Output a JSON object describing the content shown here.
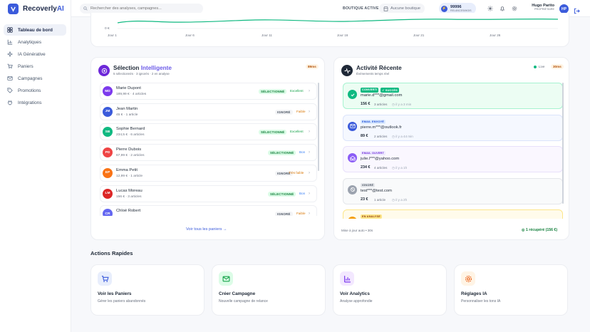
{
  "brand": {
    "name": "Recoverly",
    "accent": "AI"
  },
  "sidebar": {
    "items": [
      {
        "label": "Tableau de bord",
        "icon": "dashboard-icon",
        "active": true
      },
      {
        "label": "Analytiques",
        "icon": "chart-icon"
      },
      {
        "label": "IA Générative",
        "icon": "sparkle-icon"
      },
      {
        "label": "Paniers",
        "icon": "cart-icon"
      },
      {
        "label": "Campagnes",
        "icon": "mail-icon"
      },
      {
        "label": "Promotions",
        "icon": "tag-icon"
      },
      {
        "label": "Intégrations",
        "icon": "plug-icon"
      }
    ]
  },
  "topbar": {
    "search_placeholder": "Rechercher des analyses, campagnes...",
    "shop_label": "BOUTIQUE ACTIVE",
    "shop_value": "Aucune boutique",
    "credits_value": "99996",
    "credits_label": "RELANCES/MOIS",
    "user_name": "Hugo Parito",
    "user_role": "PROPRIÉTAIRE",
    "user_initials": "HP"
  },
  "chart": {
    "y_zero": "0 €",
    "x_labels": [
      "Jour 1",
      "Jour 6",
      "Jour 11",
      "Jour 16",
      "Jour 21",
      "Jour 26"
    ]
  },
  "chart_data": {
    "type": "line",
    "x": [
      "Jour 1",
      "Jour 6",
      "Jour 11",
      "Jour 16",
      "Jour 21",
      "Jour 26"
    ],
    "values": [
      0,
      0,
      0,
      0,
      0,
      0
    ],
    "accent": "#10b981"
  },
  "selection": {
    "title_a": "Sélection ",
    "title_b": "Intelligente",
    "subtitle": "5 sélectionnés · 3 ignorés · 2 en analyse",
    "timing": "89ms",
    "rows": [
      {
        "initials": "MD",
        "color": "#7c3aed",
        "name": "Marie Dupont",
        "meta": "189,99 € · 4 articles",
        "status": "SÉLECTIONNÉ",
        "status_kind": "sel",
        "quality": "Excellent",
        "quality_color": "#16a34a"
      },
      {
        "initials": "JM",
        "color": "#3b5bdb",
        "name": "Jean Martin",
        "meta": "45 € · 1 article",
        "status": "IGNORÉ",
        "status_kind": "ign",
        "quality": "Faible",
        "quality_color": "#d97706"
      },
      {
        "initials": "SB",
        "color": "#10b981",
        "name": "Sophie Bernard",
        "meta": "234,5 € · 6 articles",
        "status": "SÉLECTIONNÉ",
        "status_kind": "sel",
        "quality": "Excellent",
        "quality_color": "#16a34a"
      },
      {
        "initials": "PD",
        "color": "#ef4444",
        "name": "Pierre Dubois",
        "meta": "67,99 € · 2 articles",
        "status": "SÉLECTIONNÉ",
        "status_kind": "sel",
        "quality": "Bon",
        "quality_color": "#3b82f6"
      },
      {
        "initials": "EP",
        "color": "#f97316",
        "name": "Emma Petit",
        "meta": "12,99 € · 1 article",
        "status": "IGNORÉ",
        "status_kind": "ign",
        "quality": "Très faible",
        "quality_color": "#d97706"
      },
      {
        "initials": "LM",
        "color": "#dc2626",
        "name": "Lucas Moreau",
        "meta": "156 € · 3 articles",
        "status": "SÉLECTIONNÉ",
        "status_kind": "sel",
        "quality": "Bon",
        "quality_color": "#3b82f6"
      },
      {
        "initials": "CR",
        "color": "#6366f1",
        "name": "Chloé Robert",
        "meta": "",
        "status": "IGNORÉ",
        "status_kind": "ign",
        "quality": "Faible",
        "quality_color": "#d97706"
      }
    ],
    "link": "Voir tous les paniers →"
  },
  "activity": {
    "title": "Activité Récente",
    "subtitle": "Événements temps réel",
    "live": "Live",
    "timing": "30ms",
    "items": [
      {
        "tags": [
          {
            "t": "CONVERTI",
            "bg": "#10b981",
            "fg": "#ffffff"
          },
          {
            "t": "✓ SUCCÈS",
            "bg": "#10b981",
            "fg": "#ffffff"
          }
        ],
        "email": "marie.d***@gmail.com",
        "amount": "156 €",
        "articles": "3 articles",
        "time": "il y a 3 min",
        "bg": "#ecfdf3",
        "border": "#a7f3d0",
        "icon_bg": "#10b981",
        "icon": "check-icon"
      },
      {
        "tags": [
          {
            "t": "EMAIL ENVOYÉ",
            "bg": "#dbeafe",
            "fg": "#1d4ed8"
          }
        ],
        "email": "pierre.m***@outlook.fr",
        "amount": "89 €",
        "articles": "2 articles",
        "time": "il y a 44 min",
        "bg": "#f5f8ff",
        "border": "#dbe4fb",
        "icon_bg": "#3b5bdb",
        "icon": "mail-icon"
      },
      {
        "tags": [
          {
            "t": "EMAIL OUVERT",
            "bg": "#ede9fe",
            "fg": "#6d28d9"
          }
        ],
        "email": "julie.l***@yahoo.com",
        "amount": "234 €",
        "articles": "4 articles",
        "time": "il y a 1h",
        "bg": "#faf7ff",
        "border": "#e9e1fb",
        "icon_bg": "#8b5cf6",
        "icon": "mail-open-icon"
      },
      {
        "tags": [
          {
            "t": "IGNORÉ",
            "bg": "#e5e7eb",
            "fg": "#4b5563"
          }
        ],
        "email": "test***@test.com",
        "amount": "23 €",
        "articles": "1 article",
        "time": "il y a 2h",
        "bg": "#f9fafb",
        "border": "#e5e7eb",
        "icon_bg": "#9ca3af",
        "icon": "block-icon"
      },
      {
        "tags": [
          {
            "t": "EN ANALYSE",
            "bg": "#fde68a",
            "fg": "#92400e"
          }
        ],
        "email": "",
        "amount": "",
        "articles": "",
        "time": "",
        "bg": "#fffbeb",
        "border": "#fde68a",
        "icon_bg": "#f59e0b",
        "icon": "clock-icon"
      }
    ],
    "footer_left": "Mise à jour auto • 30s",
    "footer_right": "1 récupéré (156 €)"
  },
  "quick": {
    "title": "Actions Rapides",
    "cards": [
      {
        "title": "Voir les Paniers",
        "sub": "Gérer les paniers abandonnés",
        "icon": "cart-icon",
        "bg": "#e8eefc",
        "fg": "#3b5bdb"
      },
      {
        "title": "Créer Campagne",
        "sub": "Nouvelle campagne de relance",
        "icon": "mail-icon",
        "bg": "#dcfce7",
        "fg": "#16a34a"
      },
      {
        "title": "Voir Analytics",
        "sub": "Analyse approfondie",
        "icon": "chart-icon",
        "bg": "#f3e8ff",
        "fg": "#7c3aed"
      },
      {
        "title": "Réglages IA",
        "sub": "Personnaliser les tons IA",
        "icon": "gear-icon",
        "bg": "#fff4e5",
        "fg": "#ea580c"
      }
    ]
  }
}
